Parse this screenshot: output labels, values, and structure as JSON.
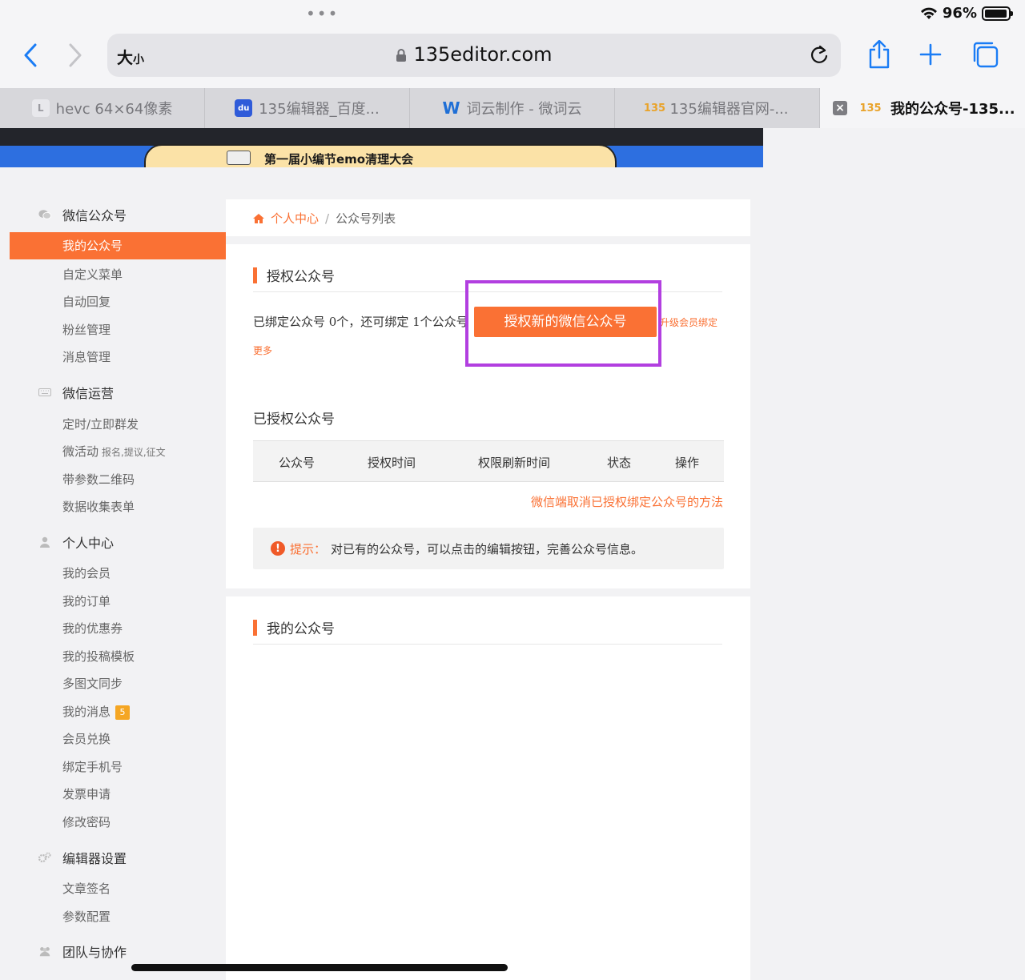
{
  "browser": {
    "status": {
      "battery_pct": "96%",
      "battery_level": 0.96
    },
    "address": {
      "text_size": "大",
      "text_size_small": "小",
      "url": "135editor.com"
    },
    "tabs": [
      {
        "title": "hevc 64×64像素",
        "favicon": "L"
      },
      {
        "title": "135编辑器_百度...",
        "favicon": "du"
      },
      {
        "title": "词云制作 - 微词云",
        "favicon": "W"
      },
      {
        "title": "135编辑器官网-...",
        "favicon": "135"
      },
      {
        "title": "我的公众号-135...",
        "favicon": "135",
        "active": true
      }
    ]
  },
  "banner": {
    "text": "第一届小编节emo清理大会"
  },
  "sidebar": {
    "groups": [
      {
        "label": "微信公众号",
        "icon": "wechat-icon",
        "items": [
          {
            "label": "我的公众号",
            "active": true
          },
          {
            "label": "自定义菜单"
          },
          {
            "label": "自动回复"
          },
          {
            "label": "粉丝管理"
          },
          {
            "label": "消息管理"
          }
        ]
      },
      {
        "label": "微信运营",
        "icon": "keyboard-icon",
        "items": [
          {
            "label": "定时/立即群发"
          },
          {
            "label": "微活动",
            "note": "报名,提议,征文"
          },
          {
            "label": "带参数二维码"
          },
          {
            "label": "数据收集表单"
          }
        ]
      },
      {
        "label": "个人中心",
        "icon": "user-icon",
        "items": [
          {
            "label": "我的会员"
          },
          {
            "label": "我的订单"
          },
          {
            "label": "我的优惠券"
          },
          {
            "label": "我的投稿模板"
          },
          {
            "label": "多图文同步"
          },
          {
            "label": "我的消息",
            "badge": "5"
          },
          {
            "label": "会员兑换"
          },
          {
            "label": "绑定手机号"
          },
          {
            "label": "发票申请"
          },
          {
            "label": "修改密码"
          }
        ]
      },
      {
        "label": "编辑器设置",
        "icon": "gears-icon",
        "items": [
          {
            "label": "文章签名"
          },
          {
            "label": "参数配置"
          }
        ]
      },
      {
        "label": "团队与协作",
        "icon": "team-icon",
        "items": []
      }
    ]
  },
  "breadcrumb": {
    "home": "个人中心",
    "sep": "/",
    "current": "公众号列表"
  },
  "auth": {
    "title": "授权公众号",
    "bound_text": "已绑定公众号 0个，还可绑定 1个公众号",
    "button": "授权新的微信公众号",
    "upgrade": "升级会员绑定",
    "more": "更多"
  },
  "authorized": {
    "title": "已授权公众号",
    "columns": [
      "公众号",
      "授权时间",
      "权限刷新时间",
      "状态",
      "操作"
    ],
    "cancel_link": "微信端取消已授权绑定公众号的方法",
    "tip_label": "提示：",
    "tip_text": "对已有的公众号，可以点击的编辑按钮，完善公众号信息。"
  },
  "mine": {
    "title": "我的公众号"
  },
  "colors": {
    "accent": "#fa7134",
    "highlight": "#b23fe0"
  }
}
